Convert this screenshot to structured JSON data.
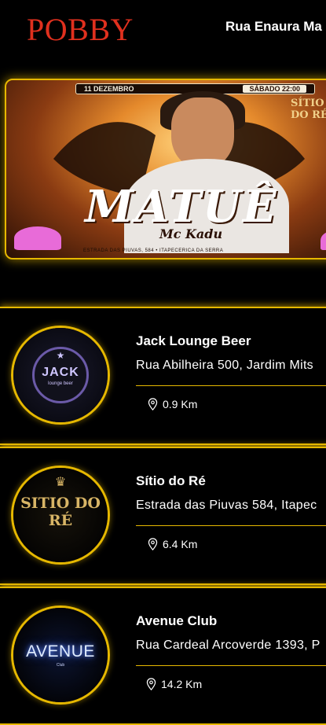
{
  "header": {
    "logo": "POBBY",
    "address": "Rua Enaura Ma"
  },
  "banner": {
    "date": "11 DEZEMBRO",
    "time_pill": "SÁBADO 22:00",
    "title": "MATUÊ",
    "subtitle": "Mc Kadu",
    "footer": "ESTRADA DAS PIUVAS, 584 • ITAPECERICA DA SERRA",
    "venue_logo": "SÍTIO DO RÉ"
  },
  "venues": [
    {
      "name": "Jack Lounge Beer",
      "address": "Rua Abilheira 500, Jardim Mits",
      "distance": "0.9 Km",
      "logo_text": "JACK",
      "logo_sub": "lounge beer"
    },
    {
      "name": "Sítio do Ré",
      "address": "Estrada das Piuvas 584, Itapec",
      "distance": "6.4 Km",
      "logo_text": "SITIO DO RÉ"
    },
    {
      "name": "Avenue Club",
      "address": "Rua Cardeal Arcoverde 1393, P",
      "distance": "14.2 Km",
      "logo_text": "AVENUE",
      "logo_sub": "Club"
    }
  ],
  "colors": {
    "accent": "#e6b800",
    "logo_red": "#e0301e",
    "background": "#000000"
  },
  "icons": {
    "distance": "map-pin-icon"
  }
}
